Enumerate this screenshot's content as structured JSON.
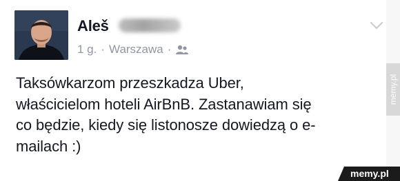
{
  "post": {
    "author_name": "Aleš",
    "time": "1 g.",
    "separator": "·",
    "location": "Warszawa",
    "audience_icon": "friends-icon",
    "options_icon": "chevron-down-icon",
    "text": "Taksówkarzom przeszkadza Uber,\nwłaścicielom hoteli AirBnB. Zastanawiam się\nco będzie, kiedy się listonosze dowiedzą o e-\nmailach :)"
  },
  "watermarks": {
    "side": "memy.pl",
    "corner": "memy.pl"
  },
  "colors": {
    "text": "#141823",
    "meta": "#9197a3",
    "watermark_bg": "#1b1b1b"
  }
}
